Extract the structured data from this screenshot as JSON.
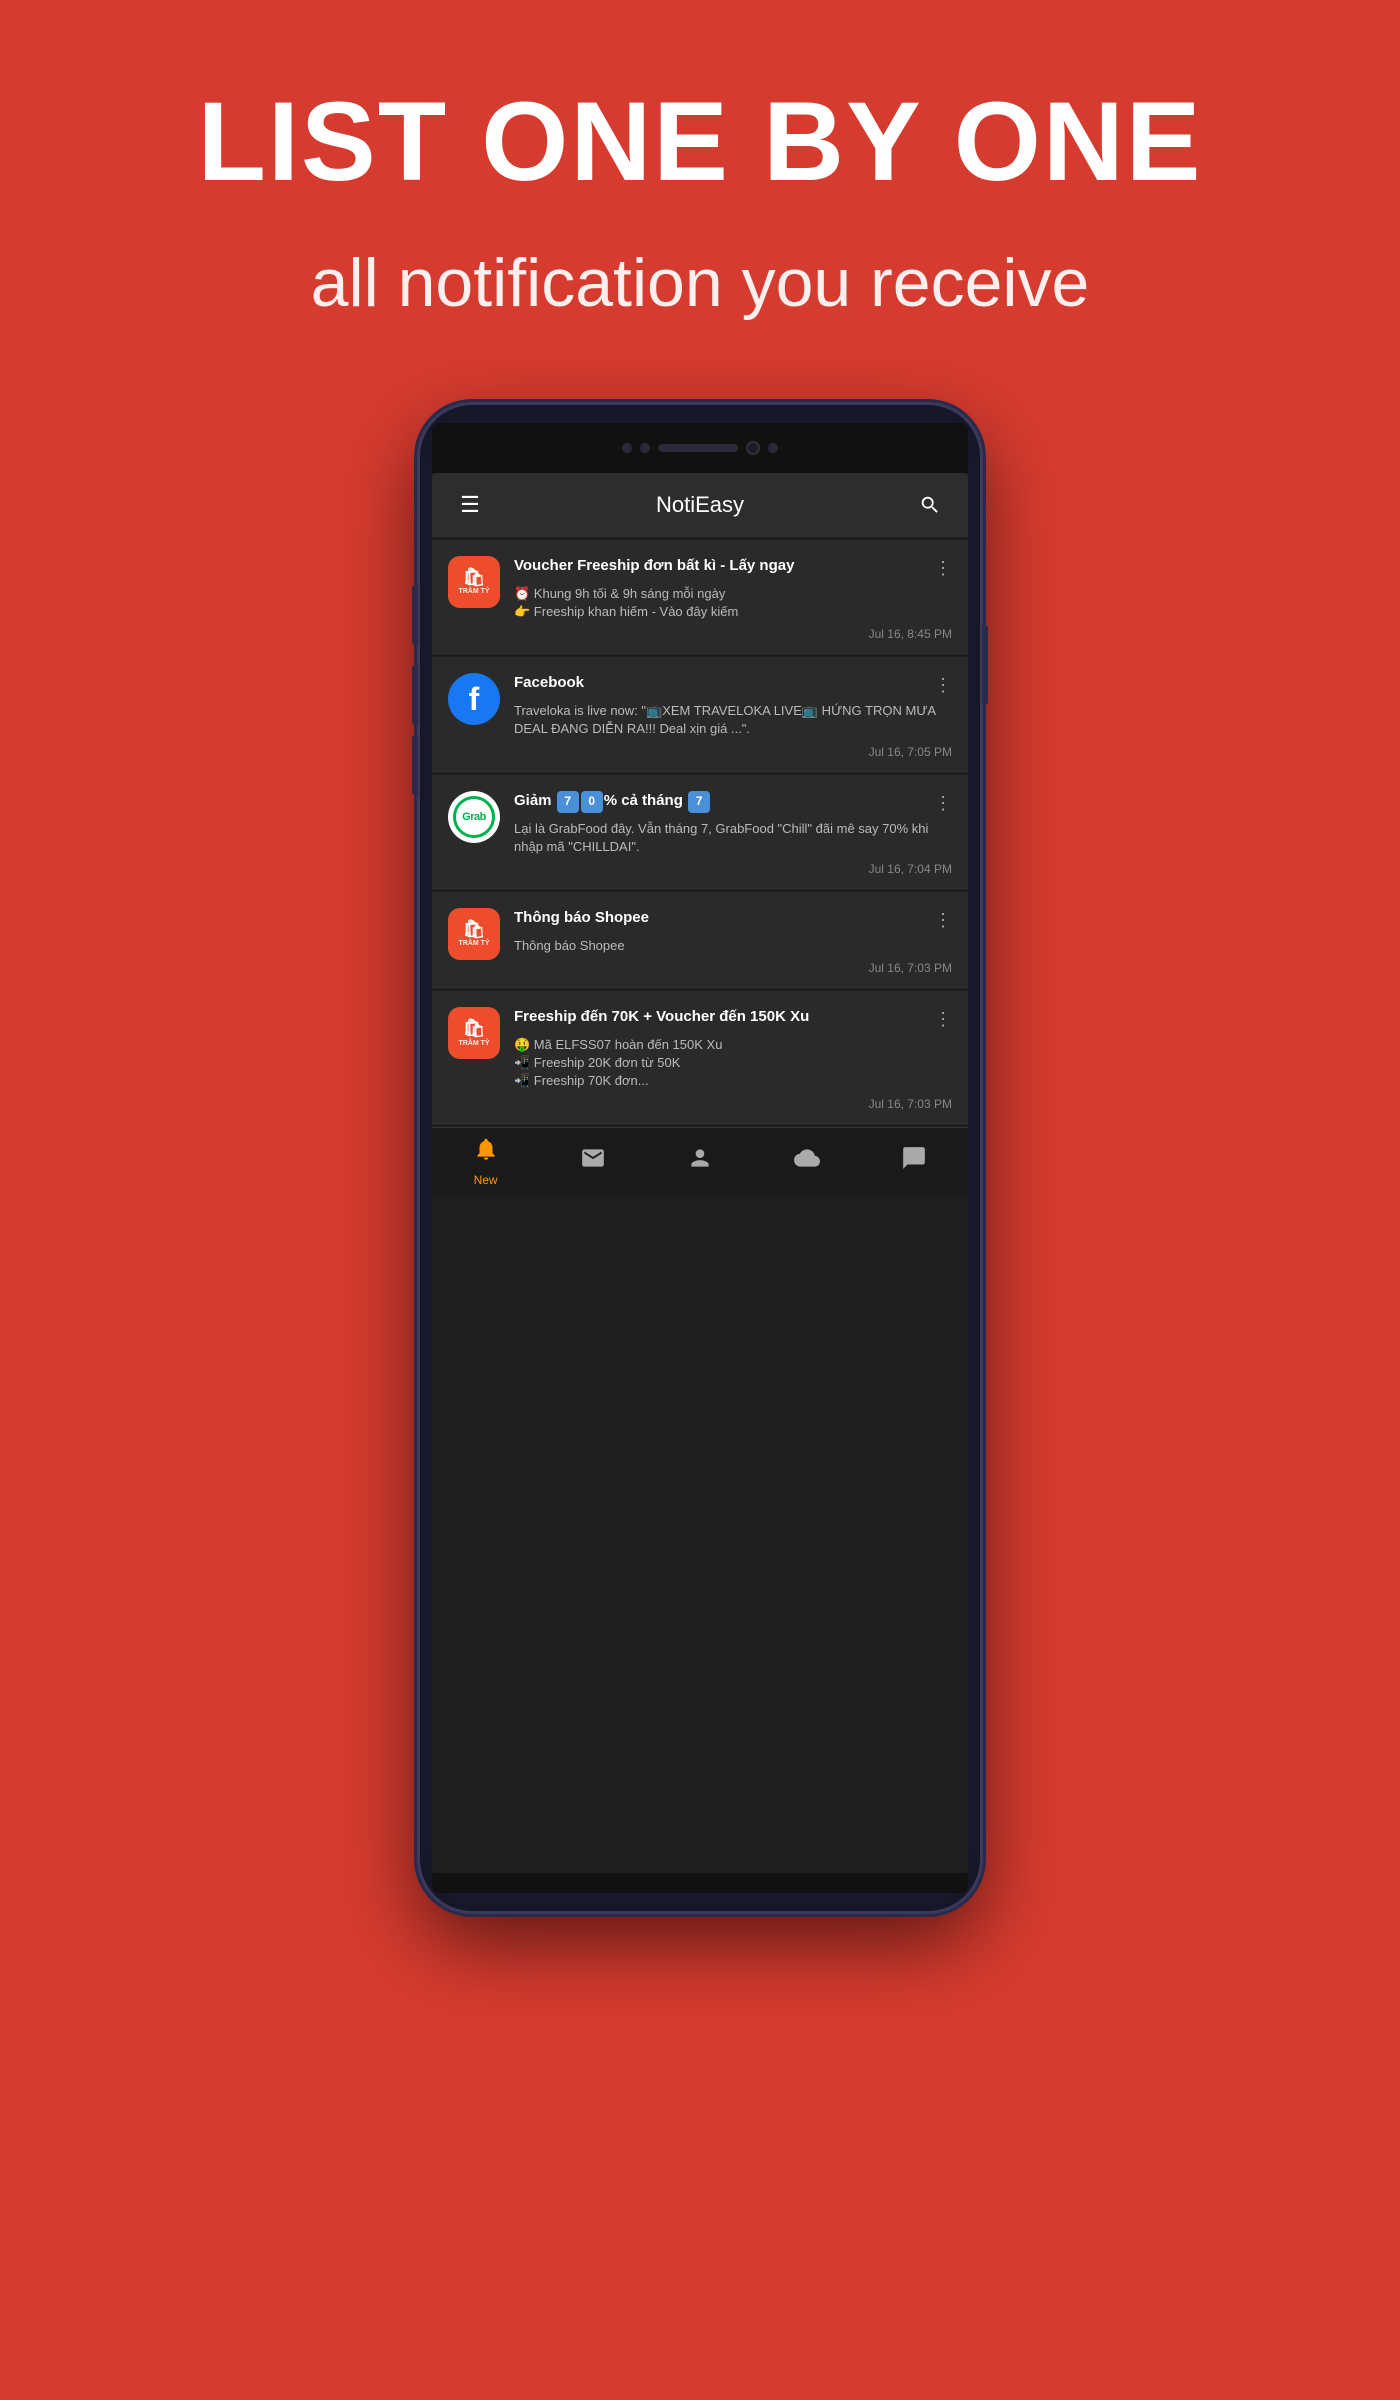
{
  "hero": {
    "title": "LIST ONE BY ONE",
    "subtitle": "all notification you receive"
  },
  "app": {
    "name": "NotiEasy",
    "menu_icon": "☰",
    "search_icon": "🔍"
  },
  "notifications": [
    {
      "id": 1,
      "app": "Shopee",
      "app_type": "shopee",
      "title": "Voucher Freeship đơn bất kì  - Lấy ngay",
      "body": "⏰ Khung 9h tối & 9h sáng mỗi ngày\n👉 Freeship khan hiếm - Vào đây kiếm",
      "time": "Jul 16, 8:45 PM"
    },
    {
      "id": 2,
      "app": "Facebook",
      "app_type": "facebook",
      "title": "Facebook",
      "body": "Traveloka is live now: \"📺XEM TRAVELOKA LIVE📺 HỨNG TRỌN MƯA DEAL ĐANG DIỄN RA!!! Deal xịn giá ...\".",
      "time": "Jul 16, 7:05 PM"
    },
    {
      "id": 3,
      "app": "Grab",
      "app_type": "grab",
      "title": "Giảm 70% cả tháng 7",
      "body": "Lại là GrabFood đây. Vẫn tháng 7, GrabFood \"Chill\" đãi mê say 70% khi nhập mã \"CHILLDAI\".",
      "time": "Jul 16, 7:04 PM"
    },
    {
      "id": 4,
      "app": "Shopee",
      "app_type": "shopee",
      "title": "Thông báo Shopee",
      "body": "Thông báo Shopee",
      "time": "Jul 16, 7:03 PM"
    },
    {
      "id": 5,
      "app": "Shopee",
      "app_type": "shopee",
      "title": "Freeship đến 70K + Voucher đến 150K Xu",
      "body": "🤑 Mã ELFSS07 hoàn đến 150K Xu\n📲 Freeship 20K đơn từ 50K\n📲 Freeship 70K đơn...",
      "time": "Jul 16, 7:03 PM"
    }
  ],
  "bottom_nav": [
    {
      "id": "new",
      "label": "New",
      "icon": "bell",
      "active": true
    },
    {
      "id": "email",
      "label": "",
      "icon": "email",
      "active": false
    },
    {
      "id": "profile",
      "label": "",
      "icon": "person",
      "active": false
    },
    {
      "id": "cloud",
      "label": "",
      "icon": "cloud",
      "active": false
    },
    {
      "id": "chat",
      "label": "",
      "icon": "chat",
      "active": false
    }
  ]
}
